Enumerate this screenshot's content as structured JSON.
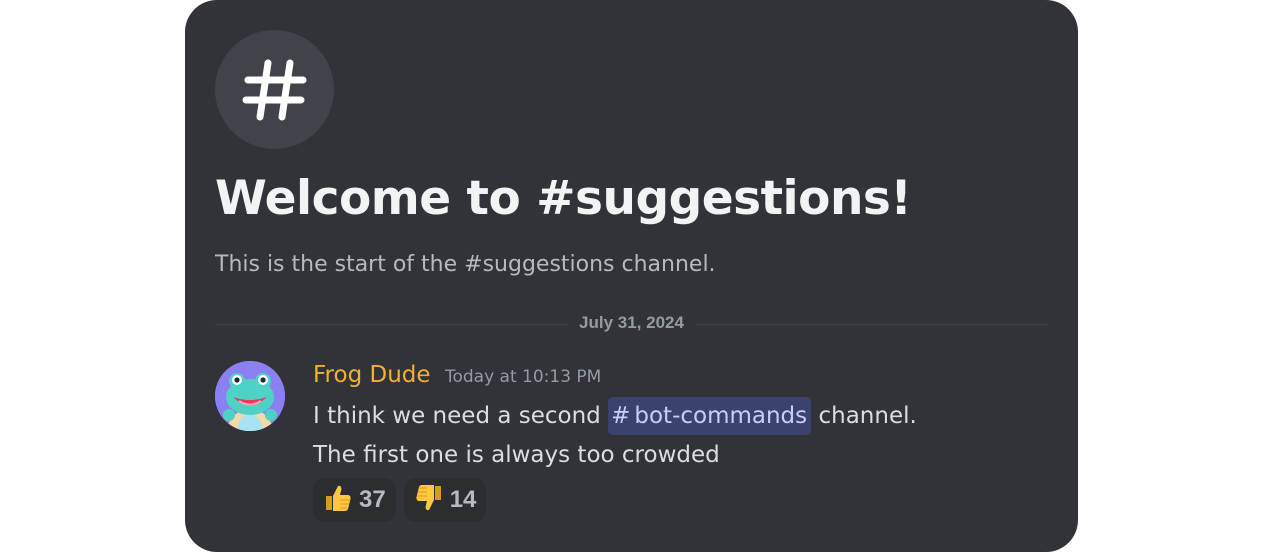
{
  "channel": {
    "welcome_title": "Welcome to #suggestions!",
    "welcome_subtitle": "This is the start of the #suggestions channel."
  },
  "divider": {
    "date": "July 31, 2024"
  },
  "message": {
    "author": "Frog Dude",
    "author_color": "#f0b132",
    "timestamp": "Today at 10:13 PM",
    "text_before_mention": "I think we need a second",
    "mention_symbol": "#",
    "mention_name": "bot-commands",
    "text_after_mention": "channel.",
    "line2": "The first one is always too crowded"
  },
  "reactions": [
    {
      "icon": "thumbs-up-icon",
      "count": "37"
    },
    {
      "icon": "thumbs-down-icon",
      "count": "14"
    }
  ],
  "colors": {
    "card_bg": "#313338",
    "mention_bg": "#3c4270",
    "mention_text": "#c9cdfb"
  }
}
